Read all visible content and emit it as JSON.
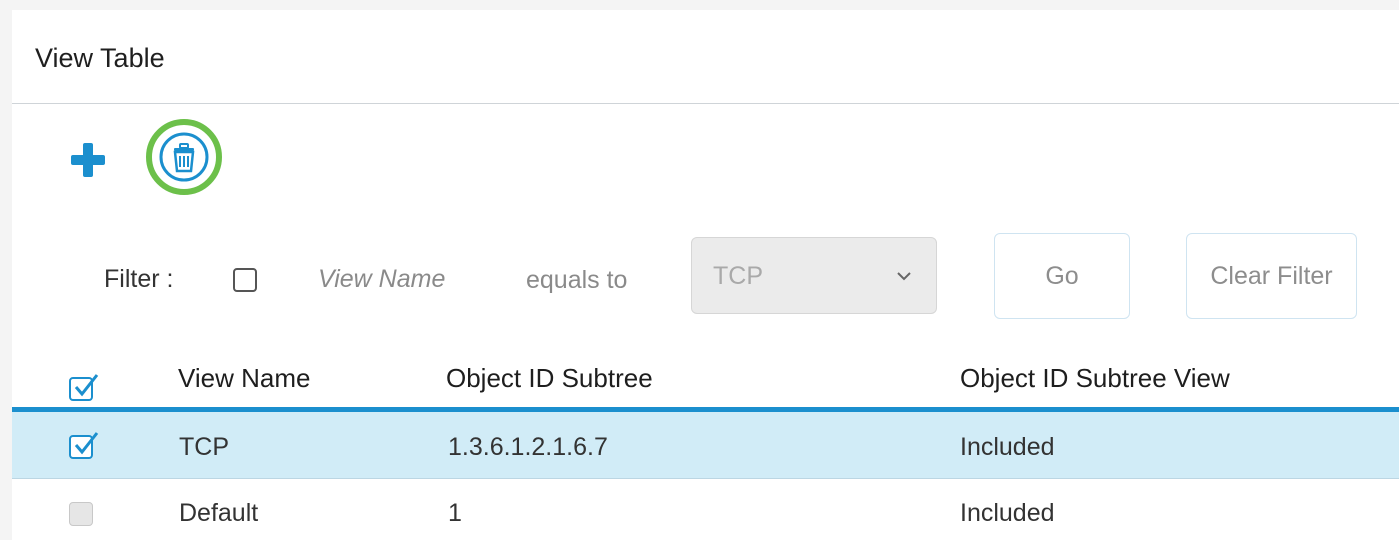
{
  "panel": {
    "title": "View Table"
  },
  "toolbar": {
    "add_icon": "plus-icon",
    "delete_icon": "trash-icon",
    "accent_color": "#1b8fce",
    "highlight_ring_color": "#6cc04a"
  },
  "filter": {
    "label": "Filter :",
    "enabled": false,
    "field_name": "View Name",
    "operator": "equals to",
    "selected_value": "TCP",
    "go_label": "Go",
    "clear_label": "Clear Filter"
  },
  "table": {
    "select_all_checked": true,
    "columns": [
      "View Name",
      "Object ID Subtree",
      "Object ID Subtree View"
    ],
    "rows": [
      {
        "checked": true,
        "view_name": "TCP",
        "oid_subtree": "1.3.6.1.2.1.6.7",
        "oid_view": "Included",
        "selected": true
      },
      {
        "checked": false,
        "view_name": "Default",
        "oid_subtree": "1",
        "oid_view": "Included",
        "selected": false
      }
    ]
  }
}
